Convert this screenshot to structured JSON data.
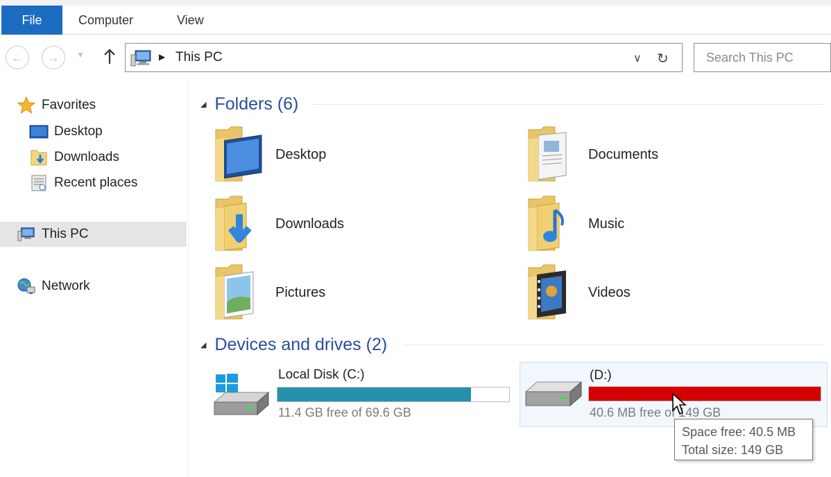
{
  "ribbon": {
    "tabs": [
      "File",
      "Computer",
      "View"
    ]
  },
  "address": {
    "path": "This PC",
    "search_placeholder": "Search This PC"
  },
  "nav": {
    "favorites_label": "Favorites",
    "favorites": [
      "Desktop",
      "Downloads",
      "Recent places"
    ],
    "this_pc": "This PC",
    "network": "Network"
  },
  "groups": {
    "folders_title": "Folders (6)",
    "drives_title": "Devices and drives (2)"
  },
  "folders": [
    "Desktop",
    "Documents",
    "Downloads",
    "Music",
    "Pictures",
    "Videos"
  ],
  "drives": [
    {
      "name": "Local Disk (C:)",
      "free_text": "11.4 GB free of 69.6 GB",
      "used_fraction": 0.836,
      "bar_color": "#2691ad"
    },
    {
      "name": "(D:)",
      "free_text": "40.6 MB free of 149 GB",
      "used_fraction": 0.9997,
      "bar_color": "#d60000"
    }
  ],
  "tooltip": {
    "line1": "Space free: 40.5 MB",
    "line2": "Total size: 149 GB"
  },
  "colors": {
    "accent": "#1c6dc2",
    "group_title": "#2a4e9a"
  }
}
